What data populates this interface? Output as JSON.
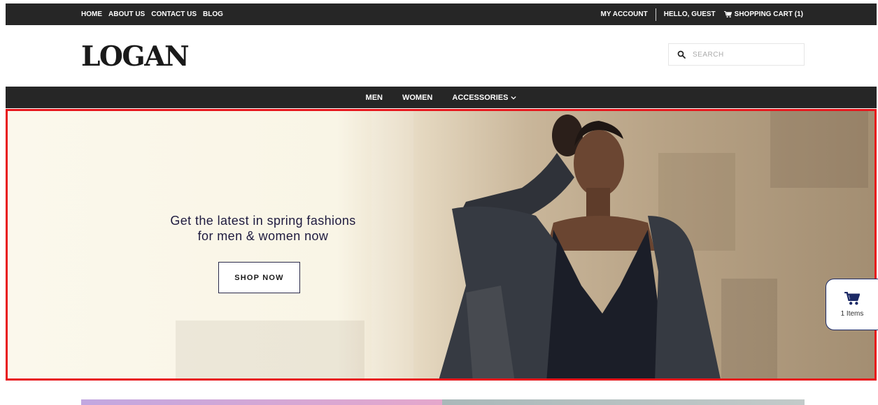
{
  "topbar": {
    "links": [
      "HOME",
      "ABOUT US",
      "CONTACT US",
      "BLOG"
    ],
    "my_account": "MY ACCOUNT",
    "greeting": "HELLO, GUEST",
    "cart": "SHOPPING CART (1)"
  },
  "header": {
    "logo": "LOGAN",
    "search_placeholder": "SEARCH"
  },
  "nav": {
    "items": [
      "MEN",
      "WOMEN",
      "ACCESSORIES"
    ]
  },
  "hero": {
    "line1": "Get the latest in spring fashions",
    "line2": "for men & women now",
    "button": "SHOP NOW"
  },
  "cart_widget": {
    "count": "1 Items"
  },
  "icons": {
    "search": "search-icon",
    "cart": "cart-icon",
    "chevron": "chevron-down-icon"
  },
  "colors": {
    "dark_bar": "#262626",
    "hero_border": "#e8151b",
    "cart_accent": "#1c2a66"
  }
}
